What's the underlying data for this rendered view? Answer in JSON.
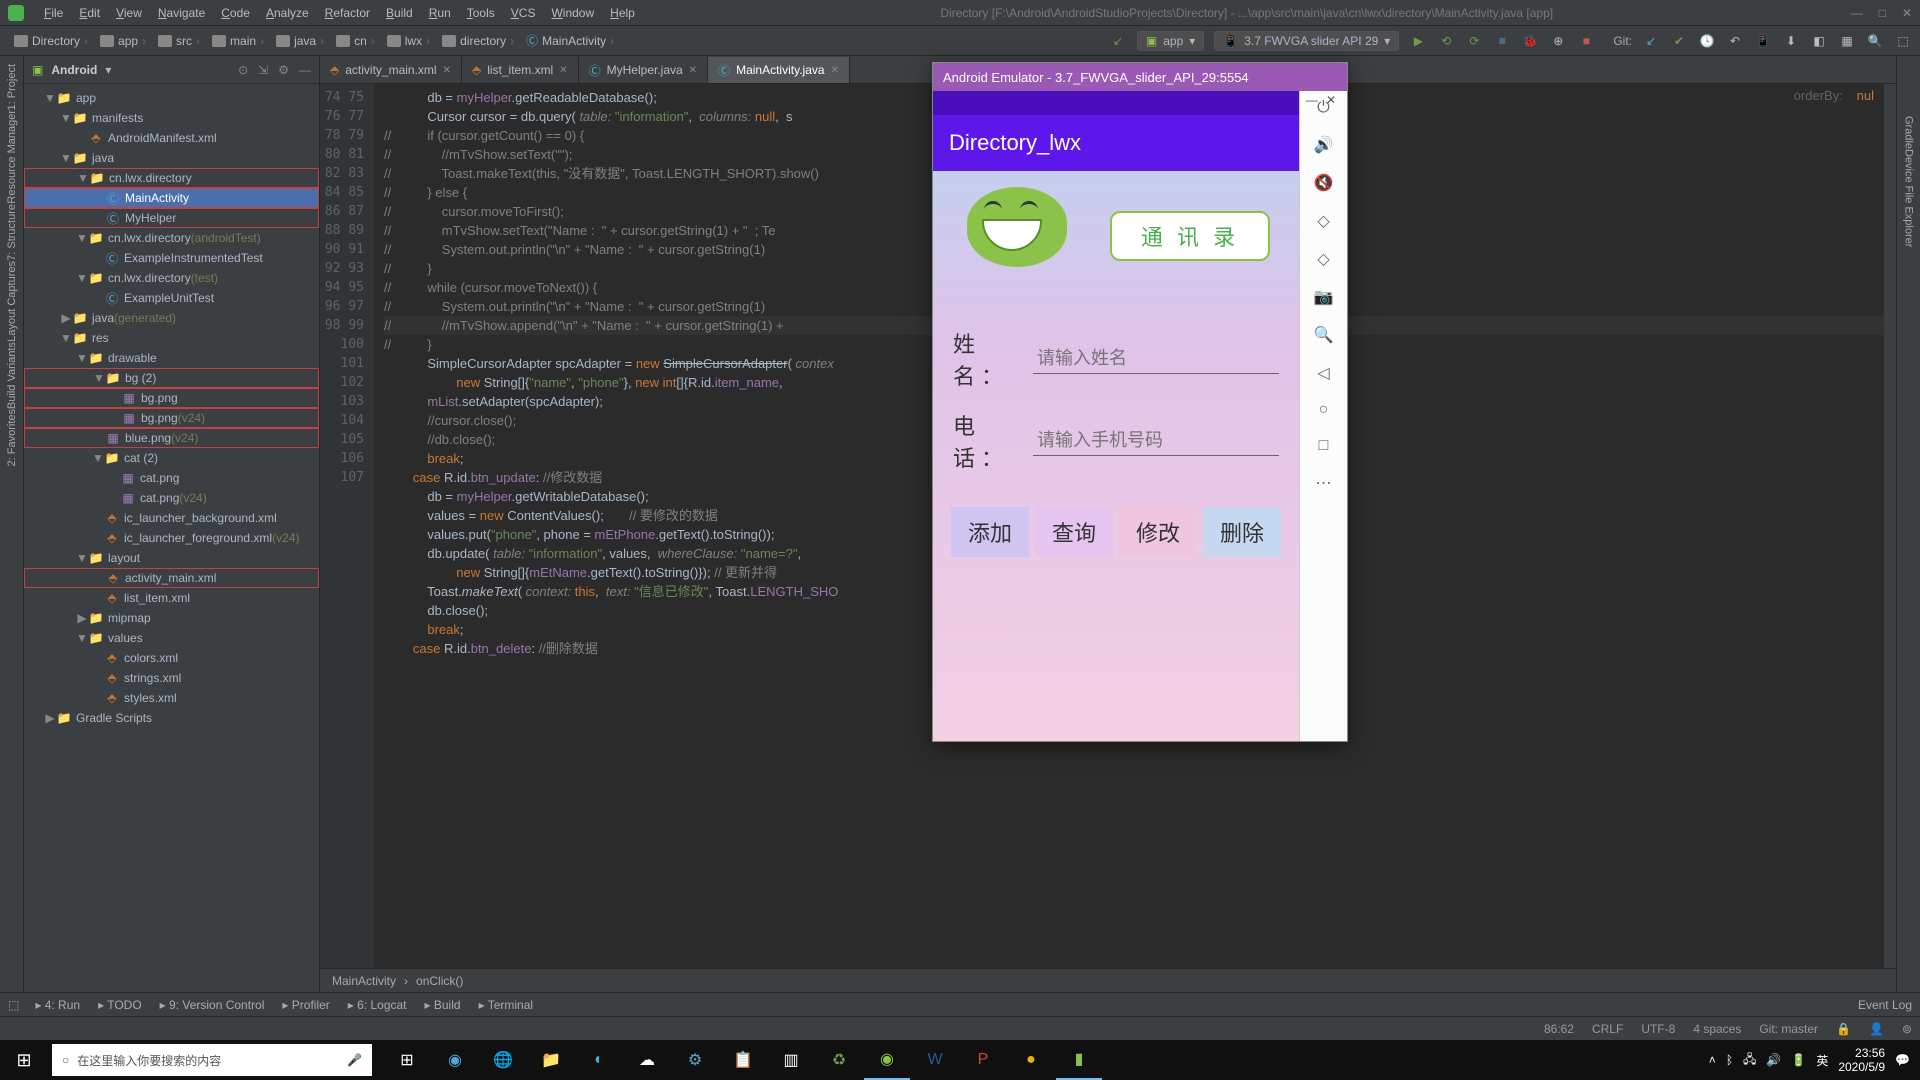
{
  "menu": {
    "items": [
      "File",
      "Edit",
      "View",
      "Navigate",
      "Code",
      "Analyze",
      "Refactor",
      "Build",
      "Run",
      "Tools",
      "VCS",
      "Window",
      "Help"
    ],
    "title": "Directory [F:\\Android\\AndroidStudioProjects\\Directory] - ...\\app\\src\\main\\java\\cn\\lwx\\directory\\MainActivity.java [app]"
  },
  "breadcrumb": [
    "Directory",
    "app",
    "src",
    "main",
    "java",
    "cn",
    "lwx",
    "directory",
    "MainActivity"
  ],
  "device": {
    "app": "app",
    "target": "3.7  FWVGA slider API 29"
  },
  "git_label": "Git:",
  "project": {
    "header": "Android",
    "tree": [
      {
        "d": 1,
        "e": "▼",
        "ico": "folder",
        "t": "app"
      },
      {
        "d": 2,
        "e": "▼",
        "ico": "folder",
        "t": "manifests"
      },
      {
        "d": 3,
        "e": "",
        "ico": "xml",
        "t": "AndroidManifest.xml"
      },
      {
        "d": 2,
        "e": "▼",
        "ico": "folder",
        "t": "java"
      },
      {
        "d": 3,
        "e": "▼",
        "ico": "folder",
        "t": "cn.lwx.directory",
        "red": true
      },
      {
        "d": 4,
        "e": "",
        "ico": "javaf",
        "t": "MainActivity",
        "red": true,
        "sel": true
      },
      {
        "d": 4,
        "e": "",
        "ico": "javaf",
        "t": "MyHelper",
        "red": true
      },
      {
        "d": 3,
        "e": "▼",
        "ico": "folder",
        "t": "cn.lwx.directory",
        "suf": "(androidTest)"
      },
      {
        "d": 4,
        "e": "",
        "ico": "javaf",
        "t": "ExampleInstrumentedTest"
      },
      {
        "d": 3,
        "e": "▼",
        "ico": "folder",
        "t": "cn.lwx.directory",
        "suf": "(test)"
      },
      {
        "d": 4,
        "e": "",
        "ico": "javaf",
        "t": "ExampleUnitTest"
      },
      {
        "d": 2,
        "e": "▶",
        "ico": "folder",
        "t": "java",
        "suf": "(generated)"
      },
      {
        "d": 2,
        "e": "▼",
        "ico": "folder",
        "t": "res"
      },
      {
        "d": 3,
        "e": "▼",
        "ico": "folder",
        "t": "drawable"
      },
      {
        "d": 4,
        "e": "▼",
        "ico": "folder",
        "t": "bg (2)",
        "red": true
      },
      {
        "d": 5,
        "e": "",
        "ico": "png",
        "t": "bg.png",
        "red": true
      },
      {
        "d": 5,
        "e": "",
        "ico": "png",
        "t": "bg.png",
        "suf": "(v24)",
        "red": true
      },
      {
        "d": 4,
        "e": "",
        "ico": "png",
        "t": "blue.png",
        "suf": "(v24)",
        "red": true
      },
      {
        "d": 4,
        "e": "▼",
        "ico": "folder",
        "t": "cat (2)"
      },
      {
        "d": 5,
        "e": "",
        "ico": "png",
        "t": "cat.png"
      },
      {
        "d": 5,
        "e": "",
        "ico": "png",
        "t": "cat.png",
        "suf": "(v24)"
      },
      {
        "d": 4,
        "e": "",
        "ico": "xml",
        "t": "ic_launcher_background.xml"
      },
      {
        "d": 4,
        "e": "",
        "ico": "xml",
        "t": "ic_launcher_foreground.xml",
        "suf": "(v24)"
      },
      {
        "d": 3,
        "e": "▼",
        "ico": "folder",
        "t": "layout"
      },
      {
        "d": 4,
        "e": "",
        "ico": "xml",
        "t": "activity_main.xml",
        "red": true
      },
      {
        "d": 4,
        "e": "",
        "ico": "xml",
        "t": "list_item.xml"
      },
      {
        "d": 3,
        "e": "▶",
        "ico": "folder",
        "t": "mipmap"
      },
      {
        "d": 3,
        "e": "▼",
        "ico": "folder",
        "t": "values"
      },
      {
        "d": 4,
        "e": "",
        "ico": "xml",
        "t": "colors.xml"
      },
      {
        "d": 4,
        "e": "",
        "ico": "xml",
        "t": "strings.xml"
      },
      {
        "d": 4,
        "e": "",
        "ico": "xml",
        "t": "styles.xml"
      },
      {
        "d": 1,
        "e": "▶",
        "ico": "folder",
        "t": "Gradle Scripts"
      }
    ]
  },
  "tabs": [
    {
      "label": "activity_main.xml",
      "ico": "xml"
    },
    {
      "label": "list_item.xml",
      "ico": "xml"
    },
    {
      "label": "MyHelper.java",
      "ico": "javaf"
    },
    {
      "label": "MainActivity.java",
      "ico": "javaf",
      "active": true
    }
  ],
  "lines": {
    "start": 74,
    "end": 107,
    "highlight": 86
  },
  "code": [
    "            db = <span class='fld'>myHelper</span>.getReadableDatabase();",
    "            Cursor cursor = db.query( <span class='ann'>table:</span> <span class='str'>\"information\"</span>,  <span class='ann'>columns:</span> <span class='kw'>null</span>,  s",
    "<span class='cm'>//          if (cursor.getCount() == 0) {</span>",
    "<span class='cm'>//              //mTvShow.setText(\"\");</span>",
    "<span class='cm'>//              Toast.makeText(this, \"没有数据\", Toast.LENGTH_SHORT).show()</span>",
    "<span class='cm'>//          } else {</span>",
    "<span class='cm'>//              cursor.moveToFirst();</span>",
    "<span class='cm'>//              mTvShow.setText(\"Name :  \" + cursor.getString(1) + \"  ; Te</span>",
    "<span class='cm'>//              System.out.println(\"\\n\" + \"Name :  \" + cursor.getString(1)</span>",
    "<span class='cm'>//          }</span>",
    "<span class='cm'>//          while (cursor.moveToNext()) {</span>",
    "<span class='cm'>//              System.out.println(\"\\n\" + \"Name :  \" + cursor.getString(1)</span>",
    "<span class='cm'>//              //mTvShow.append(\"\\n\" + \"Name :  \" + cursor.getString(1) +</span>",
    "<span class='cm'>//          }</span>",
    "",
    "",
    "            SimpleCursorAdapter spcAdapter = <span class='kw'>new</span> <span style='text-decoration:line-through'>SimpleCursorAdapter</span>( <span class='ann'>contex</span>",
    "                    <span class='kw'>new</span> String[]{<span class='str'>\"name\"</span>, <span class='str'>\"phone\"</span>}, <span class='kw'>new int</span>[]{R.id.<span class='fld'>item_name</span>,",
    "            <span class='fld'>mList</span>.setAdapter(spcAdapter);",
    "",
    "",
    "            <span class='cm'>//cursor.close();</span>",
    "            <span class='cm'>//db.close();</span>",
    "            <span class='kw'>break</span>;",
    "        <span class='kw'>case</span> R.id.<span class='fld'>btn_update</span>: <span class='cm'>//修改数据</span>",
    "            db = <span class='fld'>myHelper</span>.getWritableDatabase();",
    "            values = <span class='kw'>new</span> ContentValues();       <span class='cm'>// 要修改的数据</span>",
    "            values.put(<span class='str'>\"phone\"</span>, phone = <span class='fld'>mEtPhone</span>.getText().toString());",
    "            db.update( <span class='ann'>table:</span> <span class='str'>\"information\"</span>, values,  <span class='ann'>whereClause:</span> <span class='str'>\"name=?\"</span>,",
    "                    <span class='kw'>new</span> String[]{<span class='fld'>mEtName</span>.getText().toString()}); <span class='cm'>// 更新并得</span>",
    "            Toast.<span style='font-style:italic'>makeText</span>( <span class='ann'>context:</span> <span class='kw'>this</span>,  <span class='ann'>text:</span> <span class='str'>\"信息已修改\"</span>, Toast.<span class='fld'>LENGTH_SHO</span>",
    "            db.close();",
    "            <span class='kw'>break</span>;",
    "        <span class='kw'>case</span> R.id.<span class='fld'>btn_delete</span>: <span class='cm'>//删除数据</span>"
  ],
  "orderby_hint": "orderBy:",
  "null_hint": "nul",
  "crumb_editor": [
    "MainActivity",
    "onClick()"
  ],
  "bottom": {
    "items": [
      "4: Run",
      "TODO",
      "9: Version Control",
      "Profiler",
      "6: Logcat",
      "Build",
      "Terminal"
    ],
    "event": "Event Log"
  },
  "status": {
    "pos": "86:62",
    "lineend": "CRLF",
    "enc": "UTF-8",
    "indent": "4 spaces",
    "git": "Git: master"
  },
  "left_tabs": [
    "1: Project",
    "Resource Manager",
    "7: Structure",
    "Layout Captures",
    "Build Variants",
    "2: Favorites"
  ],
  "right_tabs": [
    "Gradle",
    "Device File Explorer"
  ],
  "emulator": {
    "title": "Android Emulator - 3.7_FWVGA_slider_API_29:5554",
    "app_title": "Directory_lwx",
    "bubble": "通 讯 录",
    "name_label": "姓 名：",
    "name_ph": "请输入姓名",
    "phone_label": "电 话：",
    "phone_ph": "请输入手机号码",
    "btns": [
      "添加",
      "查询",
      "修改",
      "删除"
    ],
    "side": [
      "⏻",
      "🔊",
      "🔇",
      "◇",
      "◇",
      "📷",
      "🔍",
      "◁",
      "○",
      "□",
      "⋯"
    ]
  },
  "taskbar": {
    "search_ph": "在这里输入你要搜索的内容",
    "time": "23:56",
    "date": "2020/5/9",
    "ime": "英"
  }
}
